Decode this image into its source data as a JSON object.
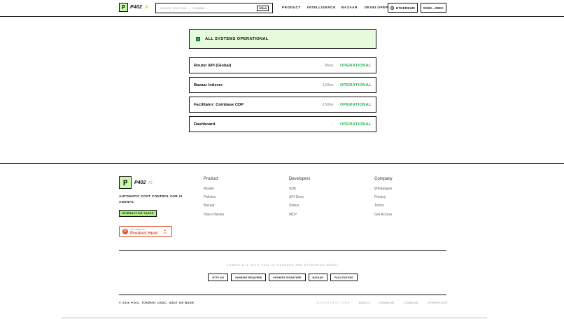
{
  "header": {
    "logo_letter": "P",
    "logo_text": "P402",
    "logo_suffix": ".io",
    "search_placeholder": "SEARCH PROTOCOL / COMMAND...",
    "search_shortcut": "CMD+K",
    "nav": [
      "PRODUCT",
      "INTELLIGENCE",
      "BAZAAR",
      "DEVELOPERS"
    ],
    "chain_label": "ETHEREUM",
    "wallet_label": "0XB2...39EC"
  },
  "status": {
    "banner": "ALL SYSTEMS OPERATIONAL",
    "services": [
      {
        "name": "Router API (Global)",
        "latency": "45ms",
        "status": "OPERATIONAL"
      },
      {
        "name": "Bazaar Indexer",
        "latency": "120ms",
        "status": "OPERATIONAL"
      },
      {
        "name": "Facilitator: Coinbase CDP",
        "latency": "150ms",
        "status": "OPERATIONAL"
      },
      {
        "name": "Dashboard",
        "latency": "-",
        "status": "OPERATIONAL"
      }
    ]
  },
  "footer": {
    "logo_letter": "P",
    "logo_text": "P402",
    "logo_suffix": ".io",
    "tagline": "AUTOMATIC COST CONTROL FOR AI AGENTS.",
    "guide_button": "INTERACTIVE GUIDE",
    "producthunt": {
      "small": "FEATURED ON",
      "big": "Product Hunt",
      "count": "100"
    },
    "columns": [
      {
        "title": "Product",
        "links": [
          "Router",
          "Policies",
          "Bazaar",
          "How it Works"
        ]
      },
      {
        "title": "Developers",
        "links": [
          "SDK",
          "API Docs",
          "Status",
          "MCP"
        ]
      },
      {
        "title": "Company",
        "links": [
          "Whitepaper",
          "Privacy",
          "Terms",
          "Get Access"
        ]
      }
    ],
    "compat_text": "COMPATIBLE WITH X402 V2 HEADERS AND EXTENSION MODEL",
    "chips": [
      "HTTP 402",
      "PAYMENT-REQUIRED",
      "PAYMENT-SIGNATURE",
      "BAZAAR",
      "FACILITATORS"
    ],
    "copyright": "© 2026 P402. TOKENS: USDC, USDT ON BASE.",
    "infra_label": "INFRASTRUCTURE",
    "infra": [
      "BASE L2",
      "CHAINLINK",
      "COINBASE",
      "OPENROUTER"
    ]
  },
  "colors": {
    "accent_green": "#27b349",
    "logo_bg": "#c8f7a8",
    "banner_bg": "#e6fbdc",
    "producthunt": "#da552f"
  }
}
